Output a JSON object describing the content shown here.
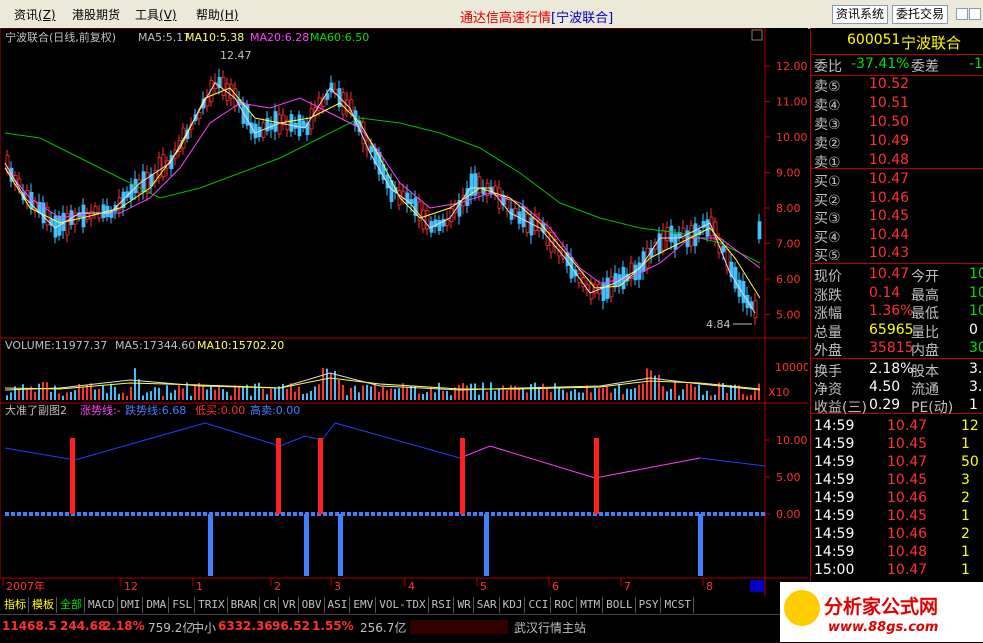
{
  "menu": {
    "items": [
      {
        "label": "资讯",
        "key": "(Z)"
      },
      {
        "label": "港股期货",
        "key": ""
      },
      {
        "label": "工具",
        "key": "(V)"
      },
      {
        "label": "帮助",
        "key": "(H)"
      }
    ],
    "title": "通达信高速行情",
    "title_sub": "[宁波联合]",
    "buttons": [
      "资讯系统",
      "委托交易"
    ]
  },
  "main_chart": {
    "header_name": "宁波联合(日线,前复权)",
    "ma5": "MA5:5.17",
    "ma10": "MA10:5.38",
    "ma20": "MA20:6.28",
    "ma60": "MA60:6.50",
    "high_label": "12.47",
    "low_label": "4.84",
    "y_ticks": [
      "12.00",
      "11.00",
      "10.00",
      "9.00",
      "8.00",
      "7.00",
      "6.00",
      "5.00"
    ]
  },
  "volume_chart": {
    "header": "VOLUME:11977.37",
    "ma5": "MA5:17344.60",
    "ma10": "MA10:15702.20",
    "y_tick": "10000",
    "unit": "X10"
  },
  "sub_chart": {
    "title": "大准了副图2",
    "s1": "涨势线:-",
    "s2": "跌势线:6.68",
    "s3": "低买:0.00",
    "s4": "高卖:0.00",
    "y_ticks": [
      "10.00",
      "5.00",
      "0.00"
    ]
  },
  "x_axis": {
    "labels": [
      "2007年",
      "12",
      "1",
      "2",
      "3",
      "4",
      "5",
      "6",
      "7",
      "8"
    ]
  },
  "quote": {
    "code": "600051",
    "name": "宁波联合",
    "wb_label": "委比",
    "wb_value": "-37.41%",
    "wc_label": "委差",
    "wc_value": "-1",
    "sells": [
      {
        "label": "卖⑤",
        "price": "10.52"
      },
      {
        "label": "卖④",
        "price": "10.51"
      },
      {
        "label": "卖③",
        "price": "10.50"
      },
      {
        "label": "卖②",
        "price": "10.49"
      },
      {
        "label": "卖①",
        "price": "10.48"
      }
    ],
    "buys": [
      {
        "label": "买①",
        "price": "10.47"
      },
      {
        "label": "买②",
        "price": "10.46"
      },
      {
        "label": "买③",
        "price": "10.45"
      },
      {
        "label": "买④",
        "price": "10.44"
      },
      {
        "label": "买⑤",
        "price": "10.43"
      }
    ],
    "stats": [
      {
        "l1": "现价",
        "v1": "10.47",
        "l2": "今开",
        "v2": "10"
      },
      {
        "l1": "涨跌",
        "v1": "0.14",
        "l2": "最高",
        "v2": "10"
      },
      {
        "l1": "涨幅",
        "v1": "1.36%",
        "l2": "最低",
        "v2": "10"
      },
      {
        "l1": "总量",
        "v1": "65965",
        "l2": "量比",
        "v2": "0"
      },
      {
        "l1": "外盘",
        "v1": "35815",
        "l2": "内盘",
        "v2": "30"
      }
    ],
    "stats2": [
      {
        "l1": "换手",
        "v1": "2.18%",
        "l2": "股本",
        "v2": "3.0"
      },
      {
        "l1": "净资",
        "v1": "4.50",
        "l2": "流通",
        "v2": "3.0"
      },
      {
        "l1": "收益(三)",
        "v1": "0.29",
        "l2": "PE(动)",
        "v2": "1"
      }
    ],
    "ticks": [
      {
        "time": "14:59",
        "price": "10.47",
        "vol": "12"
      },
      {
        "time": "14:59",
        "price": "10.45",
        "vol": "1"
      },
      {
        "time": "14:59",
        "price": "10.47",
        "vol": "50"
      },
      {
        "time": "14:59",
        "price": "10.45",
        "vol": "3"
      },
      {
        "time": "14:59",
        "price": "10.46",
        "vol": "2"
      },
      {
        "time": "14:59",
        "price": "10.45",
        "vol": "1"
      },
      {
        "time": "14:59",
        "price": "10.46",
        "vol": "2"
      },
      {
        "time": "14:59",
        "price": "10.48",
        "vol": "1"
      },
      {
        "time": "15:00",
        "price": "10.47",
        "vol": "1"
      }
    ]
  },
  "tabs": [
    "指标",
    "模板",
    "全部",
    "MACD",
    "DMI",
    "DMA",
    "FSL",
    "TRIX",
    "BRAR",
    "CR",
    "VR",
    "OBV",
    "ASI",
    "EMV",
    "VOL-TDX",
    "RSI",
    "WR",
    "SAR",
    "KDJ",
    "CCI",
    "ROC",
    "MTM",
    "BOLL",
    "PSY",
    "MCST"
  ],
  "status": {
    "index1": "11468.5",
    "chg1": "244.68",
    "pct1": "2.18%",
    "amt1": "759.2亿",
    "label2": "中小",
    "index2": "6332.36",
    "chg2": "96.52",
    "pct2": "1.55%",
    "amt2": "256.7亿",
    "station": "武汉行情主站"
  },
  "logo": {
    "text": "分析家公式网",
    "url": "www.88gs.com"
  }
}
